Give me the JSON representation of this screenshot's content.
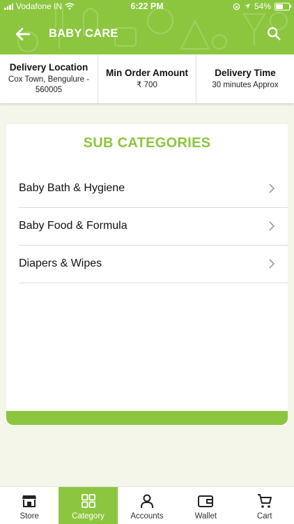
{
  "status_bar": {
    "carrier": "Vodafone IN",
    "time": "6:22 PM",
    "battery": "54%",
    "battery_level": 0.54
  },
  "header": {
    "title": "BABY CARE",
    "back_icon": "arrow-left-icon",
    "search_icon": "search-icon"
  },
  "info_bar": {
    "delivery_location": {
      "title": "Delivery Location",
      "value": "Cox Town, Bengulure - 560005"
    },
    "min_order": {
      "title": "Min Order Amount",
      "value": "₹ 700"
    },
    "delivery_time": {
      "title": "Delivery Time",
      "value": "30 minutes Approx"
    }
  },
  "subcategories": {
    "heading": "SUB CATEGORIES",
    "items": [
      {
        "label": "Baby Bath & Hygiene"
      },
      {
        "label": "Baby Food & Formula"
      },
      {
        "label": "Diapers & Wipes"
      }
    ]
  },
  "tab_bar": {
    "tabs": [
      {
        "label": "Store",
        "icon": "store-icon"
      },
      {
        "label": "Category",
        "icon": "grid-icon",
        "active": true
      },
      {
        "label": "Accounts",
        "icon": "user-icon"
      },
      {
        "label": "Wallet",
        "icon": "wallet-icon"
      },
      {
        "label": "Cart",
        "icon": "cart-icon"
      }
    ]
  },
  "colors": {
    "brand_green": "#8cc63f",
    "background": "#f3f6e8"
  }
}
